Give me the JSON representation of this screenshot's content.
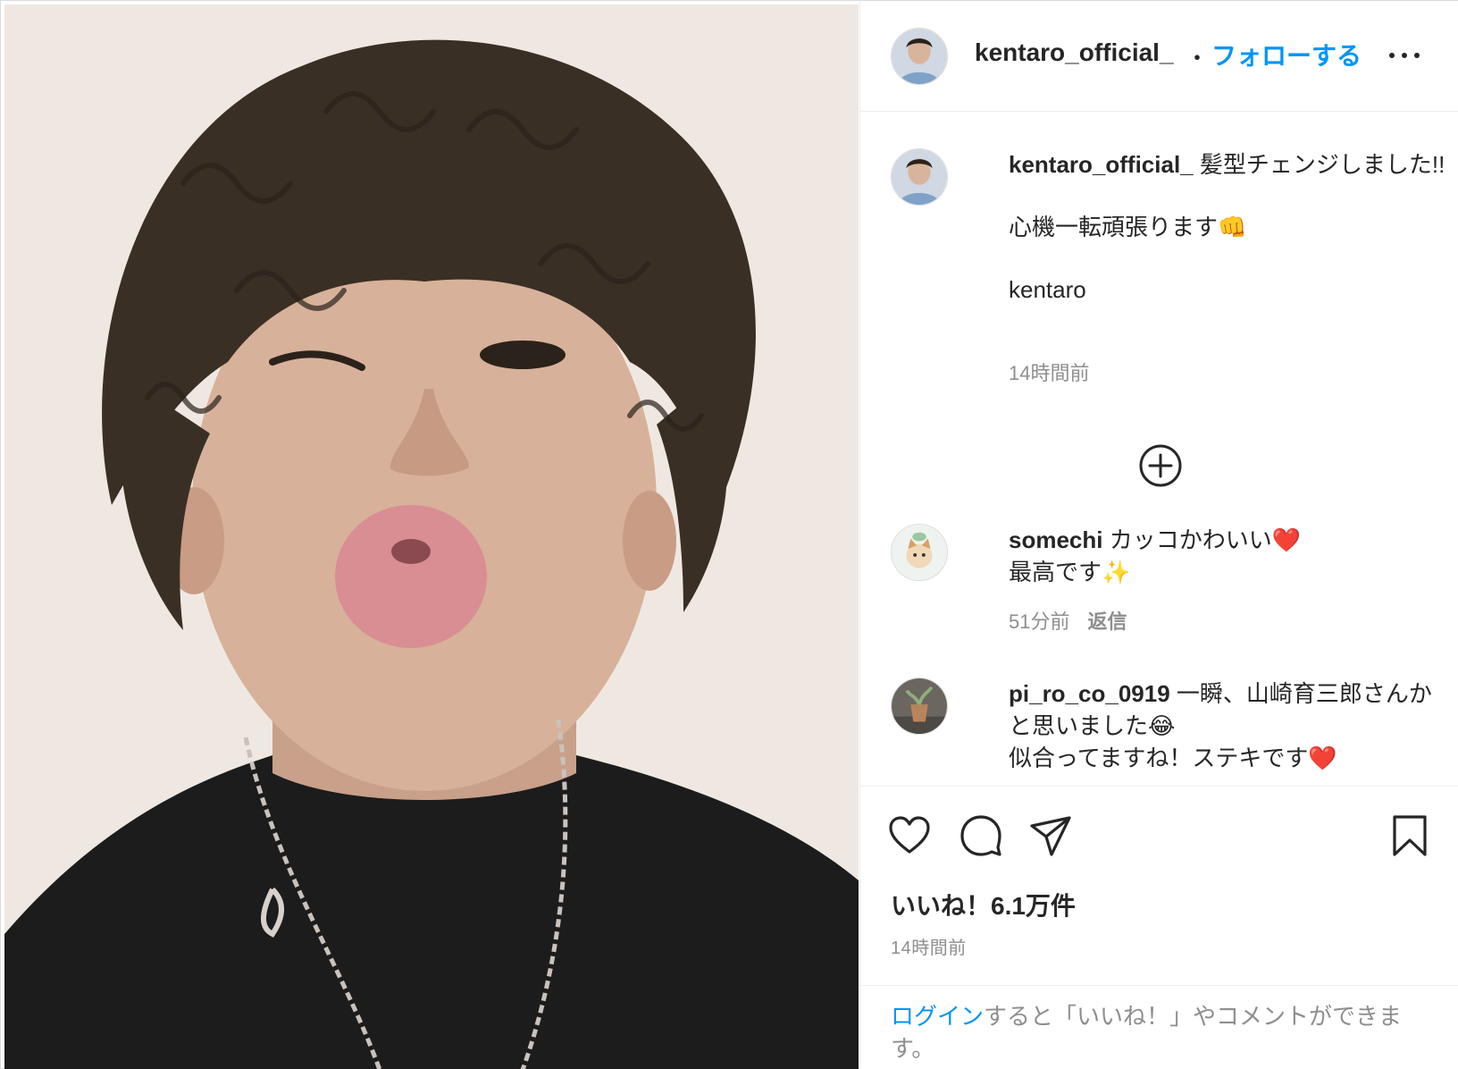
{
  "post": {
    "username": "kentaro_official_",
    "separator": "・",
    "follow_label": "フォローする",
    "photo": {
      "subject": "selfie-portrait"
    }
  },
  "caption": {
    "username": "kentaro_official_",
    "line1": "髪型チェンジしました!!",
    "line2": "心機一転頑張ります👊",
    "line3": "kentaro",
    "time": "14時間前"
  },
  "comments": [
    {
      "username": "somechi",
      "text": "カッコかわいい❤️",
      "text2": "最高です✨",
      "time": "51分前",
      "reply_label": "返信"
    },
    {
      "username": "pi_ro_co_0919",
      "text": "一瞬、山崎育三郎さんかと思いました😂",
      "text2": "似合ってますね！ステキです❤️"
    }
  ],
  "actions": {
    "likes": "いいね！6.1万件",
    "time": "14時間前"
  },
  "login_prompt": {
    "login_label": "ログイン",
    "rest": "すると「いいね！」やコメントができます。"
  },
  "colors": {
    "link": "#0095f6",
    "muted": "#8e8e8e",
    "text": "#262626"
  }
}
